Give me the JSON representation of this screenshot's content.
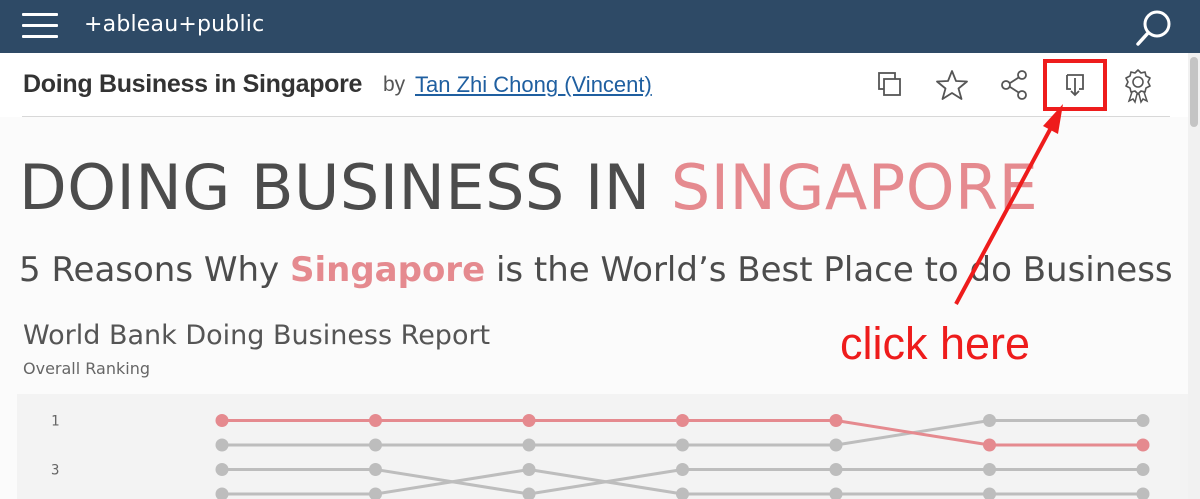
{
  "topbar": {
    "logo_text": "+ableau+public",
    "menu_icon": "hamburger-menu-icon",
    "search_icon": "search-icon",
    "bg_color": "#2e4a66"
  },
  "titlebar": {
    "title": "Doing Business in Singapore",
    "by": "by",
    "author": "Tan Zhi Chong (Vincent)",
    "tools": [
      {
        "name": "copy-icon"
      },
      {
        "name": "star-icon"
      },
      {
        "name": "share-icon"
      },
      {
        "name": "download-icon"
      },
      {
        "name": "award-icon"
      }
    ]
  },
  "viz": {
    "heading_part1": "DOING BUSINESS IN ",
    "heading_part2": "SINGAPORE",
    "sub_part1": "5 Reasons Why ",
    "sub_part2": "Singapore",
    "sub_part3": " is the World’s Best Place to do Business",
    "report_title": "World Bank Doing Business Report",
    "report_subtitle": "Overall Ranking",
    "accent_color": "#e58a8f"
  },
  "chart_data": {
    "type": "line",
    "ylabel": "",
    "y_tick_labels": [
      "1",
      "3"
    ],
    "y_inverted": true,
    "series": [
      {
        "highlight": true,
        "color": "#e58a8f",
        "values": [
          1,
          1,
          1,
          1,
          1,
          2,
          2
        ]
      },
      {
        "highlight": false,
        "color": "#bdbdbd",
        "values": [
          2,
          2,
          2,
          2,
          2,
          1,
          1
        ]
      },
      {
        "highlight": false,
        "color": "#bdbdbd",
        "values": [
          3,
          3,
          4,
          3,
          3,
          3,
          3
        ]
      },
      {
        "highlight": false,
        "color": "#bdbdbd",
        "values": [
          4,
          4,
          3,
          4,
          4,
          4,
          4
        ]
      }
    ]
  },
  "annotation": {
    "text": "click here",
    "color": "#ee1c1c"
  }
}
